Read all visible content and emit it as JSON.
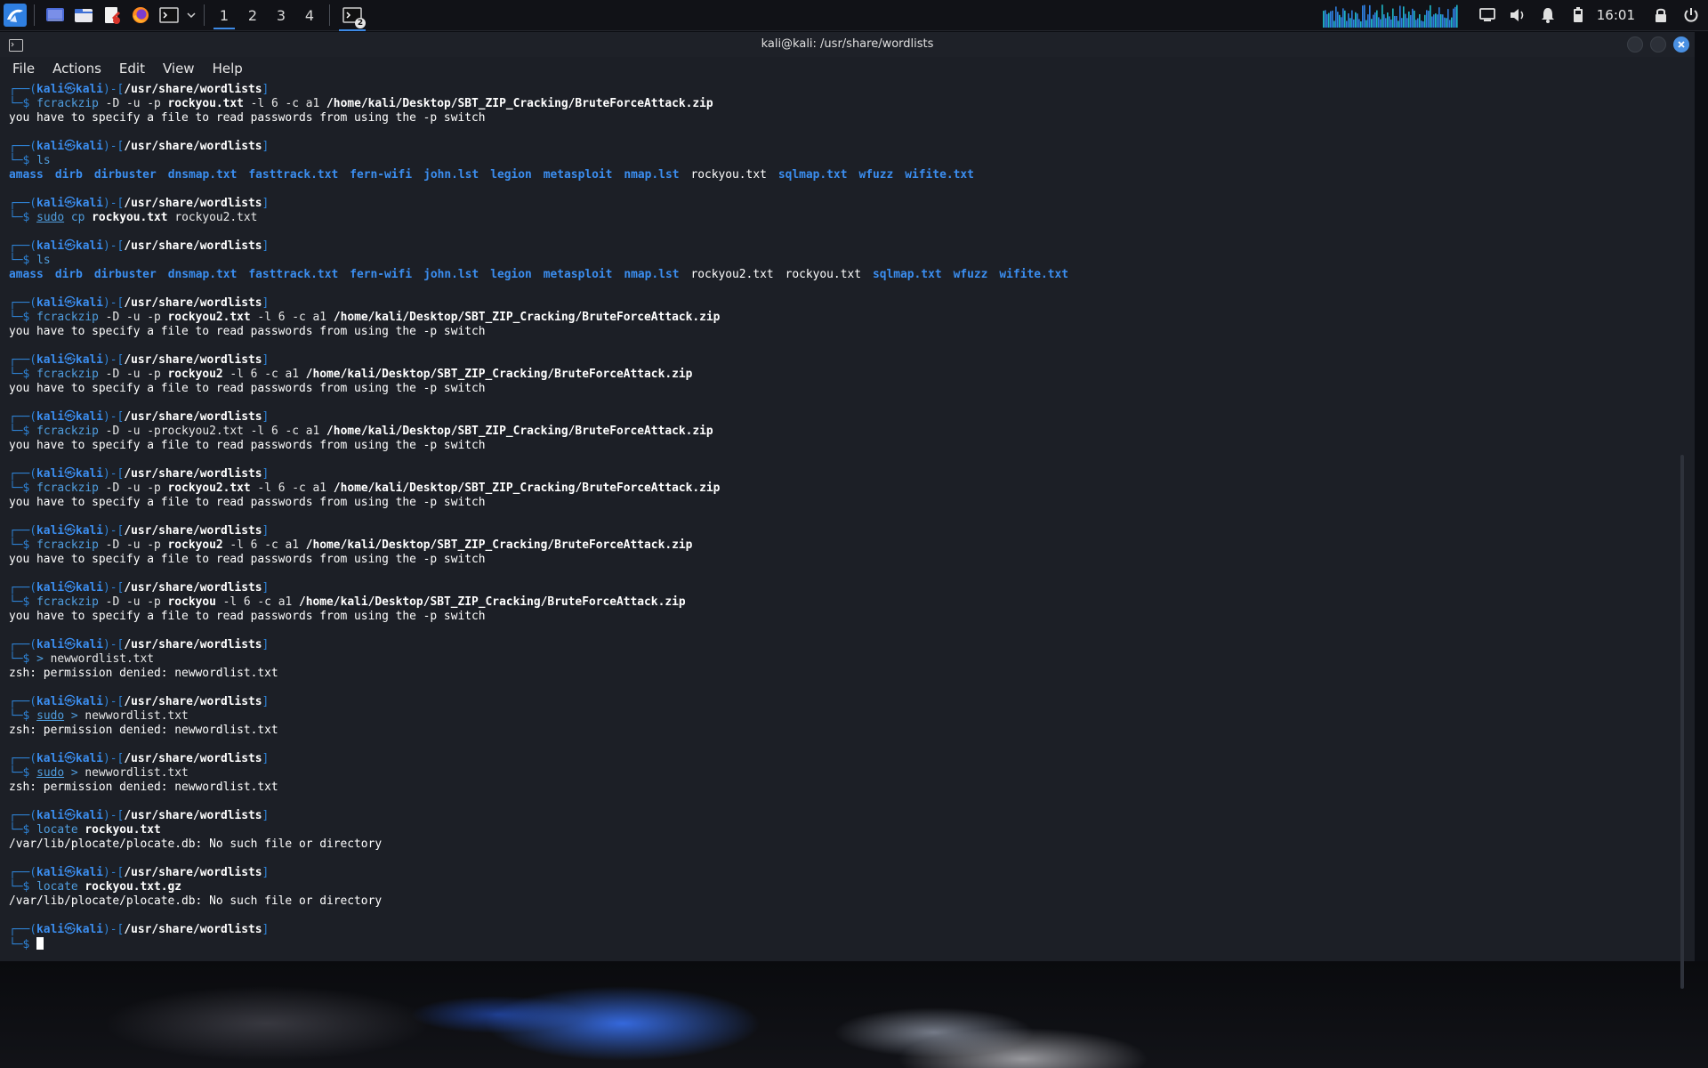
{
  "taskbar": {
    "workspaces": [
      "1",
      "2",
      "3",
      "4"
    ],
    "terminal_task_badge": "2",
    "clock": "16:01"
  },
  "window": {
    "title": "kali@kali: /usr/share/wordlists"
  },
  "menu": [
    "File",
    "Actions",
    "Edit",
    "View",
    "Help"
  ],
  "prompt": {
    "user": "kali",
    "at": "㉿",
    "host": "kali",
    "path": "/usr/share/wordlists",
    "top_prefix": "┌──(",
    "sep": ")-[",
    "close": "]",
    "bottom_prefix": "└─$"
  },
  "terminal": {
    "cmd1": {
      "bin": "fcrackzip",
      "flags": " -D -u -p ",
      "arg": "rockyou.txt",
      "mid": " -l 6 -c a1 ",
      "file": "/home/kali/Desktop/SBT_ZIP_Cracking/BruteForceAttack.zip"
    },
    "err": "you have to specify a file to read passwords from using the -p switch",
    "ls": "ls",
    "ls1": [
      "amass",
      "dirb",
      "dirbuster",
      "dnsmap.txt",
      "fasttrack.txt",
      "fern-wifi",
      "john.lst",
      "legion",
      "metasploit",
      "nmap.lst",
      "rockyou.txt",
      "sqlmap.txt",
      "wfuzz",
      "wifite.txt"
    ],
    "cp": {
      "sudo": "sudo",
      "bin": "cp",
      "arg1": "rockyou.txt",
      "arg2": "rockyou2.txt"
    },
    "ls2": [
      "amass",
      "dirb",
      "dirbuster",
      "dnsmap.txt",
      "fasttrack.txt",
      "fern-wifi",
      "john.lst",
      "legion",
      "metasploit",
      "nmap.lst",
      "rockyou2.txt",
      "rockyou.txt",
      "sqlmap.txt",
      "wfuzz",
      "wifite.txt"
    ],
    "cmd2": {
      "bin": "fcrackzip",
      "flags": " -D -u -p ",
      "arg": "rockyou2.txt",
      "mid": " -l 6 -c a1 ",
      "file": "/home/kali/Desktop/SBT_ZIP_Cracking/BruteForceAttack.zip"
    },
    "cmd3": {
      "bin": "fcrackzip",
      "flags": " -D -u -p ",
      "arg": "rockyou2",
      "mid": " -l 6 -c a1 ",
      "file": "/home/kali/Desktop/SBT_ZIP_Cracking/BruteForceAttack.zip"
    },
    "cmd4": {
      "bin": "fcrackzip",
      "flags": " -D -u -prockyou2.txt",
      "mid": " -l 6 -c a1 ",
      "file": "/home/kali/Desktop/SBT_ZIP_Cracking/BruteForceAttack.zip"
    },
    "cmd5": {
      "bin": "fcrackzip",
      "flags": " -D -u -p ",
      "arg": "rockyou2.txt",
      "mid": " -l 6 -c a1 ",
      "file": "/home/kali/Desktop/SBT_ZIP_Cracking/BruteForceAttack.zip"
    },
    "cmd6": {
      "bin": "fcrackzip",
      "flags": " -D -u -p ",
      "arg": "rockyou2",
      "mid": " -l 6 -c a1 ",
      "file": "/home/kali/Desktop/SBT_ZIP_Cracking/BruteForceAttack.zip"
    },
    "cmd7": {
      "bin": "fcrackzip",
      "flags": " -D -u -p ",
      "arg": "rockyou",
      "mid": " -l 6 -c a1 ",
      "file": "/home/kali/Desktop/SBT_ZIP_Cracking/BruteForceAttack.zip"
    },
    "redir": {
      "op": ">",
      "file": "newwordlist.txt"
    },
    "denied": "zsh: permission denied: newwordlist.txt",
    "sudo_redir": {
      "sudo": "sudo",
      "op": ">",
      "file": "newwordlist.txt"
    },
    "locate1": {
      "bin": "locate",
      "arg": "rockyou.txt"
    },
    "locate2": {
      "bin": "locate",
      "arg": "rockyou.txt.gz"
    },
    "locate_err": "/var/lib/plocate/plocate.db: No such file or directory"
  },
  "colors": {
    "accent": "#3b8ef0",
    "terminal_bg": "#1c1f26",
    "close_button": "#4a90e2"
  }
}
